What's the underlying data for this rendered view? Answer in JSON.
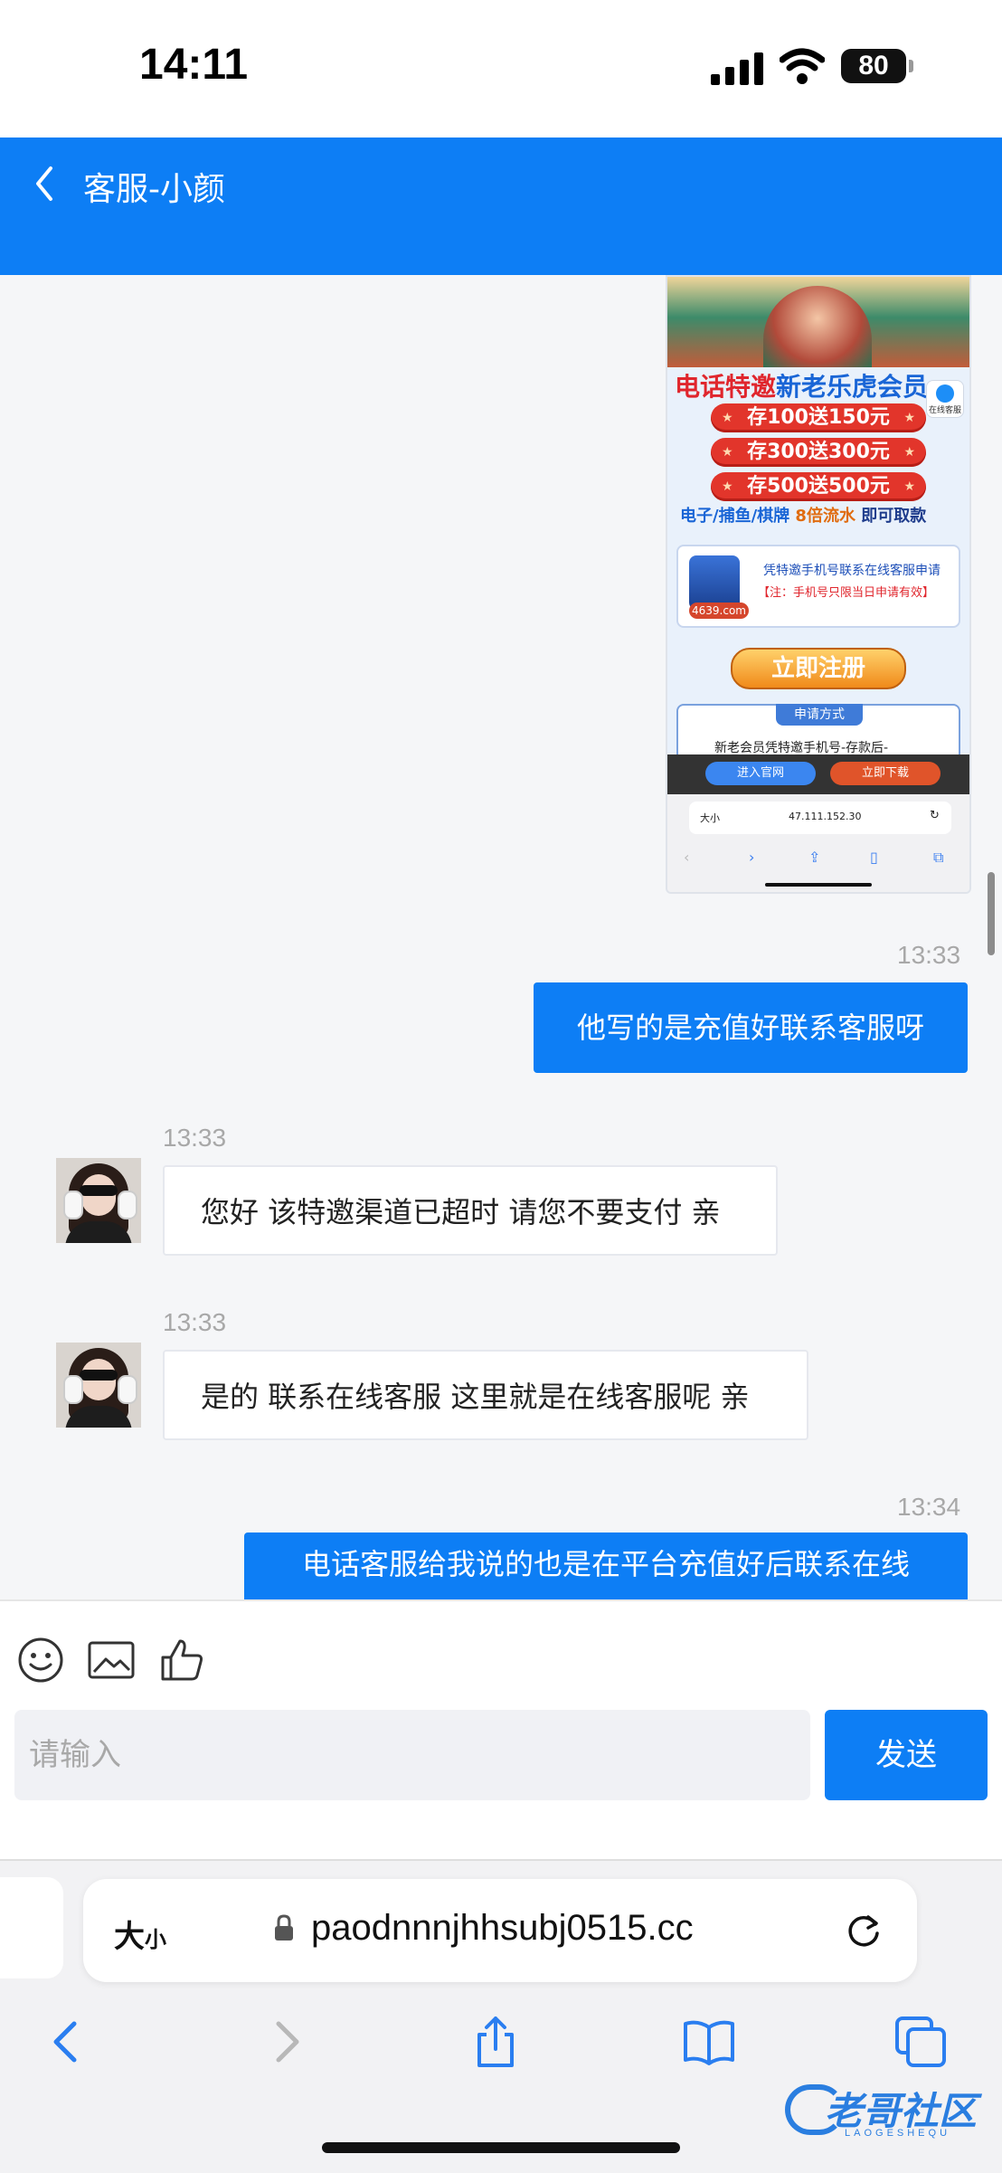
{
  "status_bar": {
    "time": "14:11",
    "battery": "80"
  },
  "header": {
    "title": "客服-小颜",
    "accent_color": "#0d7ef5"
  },
  "poster": {
    "headline_red": "电话特邀",
    "headline_blue": "新老乐虎会员",
    "kefu_badge": "在线客服",
    "offers": [
      "存100送150元",
      "存300送300元",
      "存500送500元"
    ],
    "flow_part1": "电子/捕鱼/棋牌 ",
    "flow_part2": "8倍流水",
    "flow_part3": " 即可取款",
    "logo_text": "4639.com",
    "card_line1": "凭特邀手机号联系在线客服申请",
    "card_line2": "【注：手机号只限当日申请有效】",
    "register_label": "立即注册",
    "apply_tab": "申请方式",
    "apply_text": "新老会员凭特邀手机号-存款后-",
    "bar_left": "进入官网",
    "bar_right": "立即下载",
    "mini_aa": "大小",
    "mini_address": "47.111.152.30"
  },
  "messages": [
    {
      "time": "13:33",
      "direction": "out",
      "text": "他写的是充值好联系客服呀"
    },
    {
      "time": "13:33",
      "direction": "in",
      "text": "您好 该特邀渠道已超时 请您不要支付 亲"
    },
    {
      "time": "13:33",
      "direction": "in",
      "text": "是的 联系在线客服 这里就是在线客服呢 亲"
    },
    {
      "time": "13:34",
      "direction": "out",
      "text": "电话客服给我说的也是在平台充值好后联系在线"
    }
  ],
  "composer": {
    "placeholder": "请输入",
    "send_label": "发送",
    "tools": [
      "emoji-icon",
      "image-icon",
      "thumbs-up-icon"
    ]
  },
  "safari": {
    "aa_label": "大",
    "aa_small": "小",
    "url": "paodnnnjhhsubj0515.cc"
  },
  "watermark": {
    "main": "老哥社区",
    "sub": "LAOGESHEQU"
  }
}
